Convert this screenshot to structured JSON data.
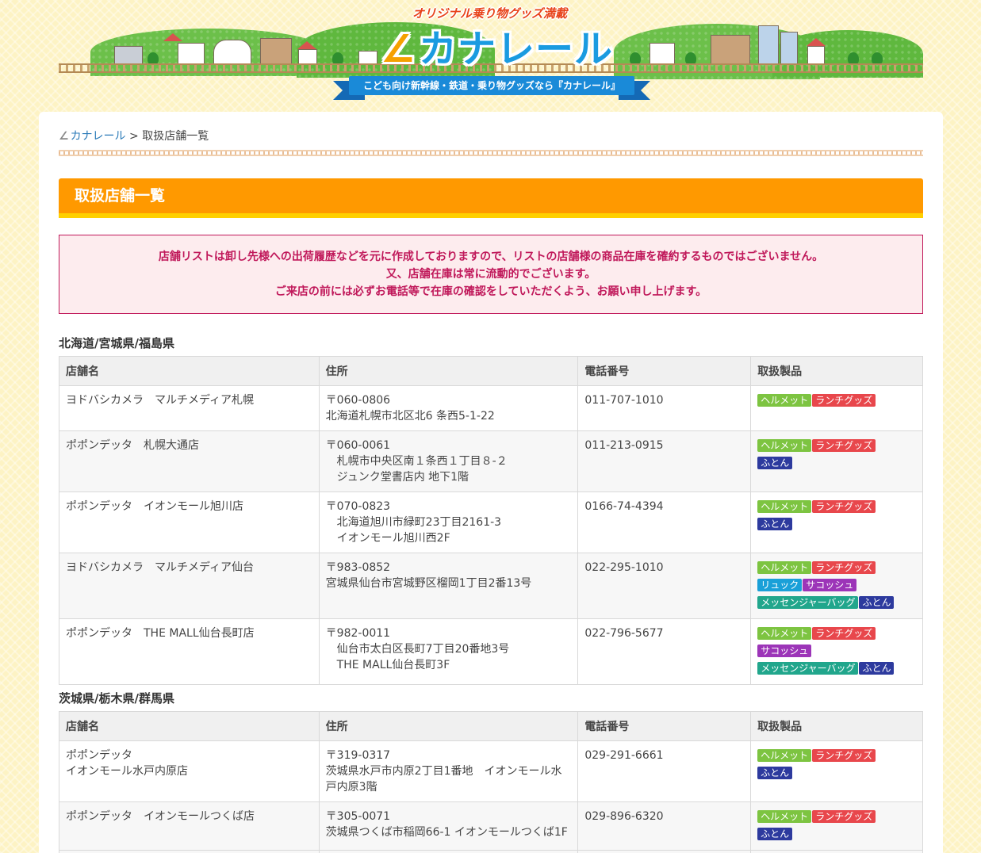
{
  "header": {
    "tagline_top": "オリジナル乗り物グッズ満載",
    "logo_text": "カナレール",
    "ribbon_text": "こども向け新幹線・鉄道・乗り物グッズなら『カナレール』"
  },
  "breadcrumb": {
    "home": "カナレール",
    "separator": ">",
    "current": "取扱店舗一覧"
  },
  "page_title": "取扱店舗一覧",
  "notice": {
    "line1": "店舗リストは卸し先様への出荷履歴などを元に作成しておりますので、リストの店舗様の商品在庫を確約するものではございません。",
    "line2": "又、店舗在庫は常に流動的でございます。",
    "line3": "ご来店の前には必ずお電話等で在庫の確認をしていただくよう、お願い申し上げます。"
  },
  "columns": {
    "name": "店舗名",
    "address": "住所",
    "phone": "電話番号",
    "products": "取扱製品"
  },
  "tag_labels": {
    "helmet": "ヘルメット",
    "lunch": "ランチグッズ",
    "futon": "ふとん",
    "ryuck": "リュック",
    "sacoche": "サコッシュ",
    "messenger": "メッセンジャーバッグ"
  },
  "regions": [
    {
      "name": "北海道/宮城県/福島県",
      "stores": [
        {
          "name": "ヨドバシカメラ　マルチメディア札幌",
          "zip": "〒060-0806",
          "addr": "北海道札幌市北区北6 条西5-1-22",
          "addr2": "",
          "phone": "011-707-1010"
        },
        {
          "name": "ポポンデッタ　札幌大通店",
          "zip": "〒060-0061",
          "addr": "札幌市中央区南１条西１丁目８-２",
          "addr2": "ジュンク堂書店内 地下1階",
          "phone": "011-213-0915"
        },
        {
          "name": "ポポンデッタ　イオンモール旭川店",
          "zip": "〒070-0823",
          "addr": "北海道旭川市緑町23丁目2161-3",
          "addr2": "イオンモール旭川西2F",
          "phone": "0166-74-4394"
        },
        {
          "name": "ヨドバシカメラ　マルチメディア仙台",
          "zip": "〒983-0852",
          "addr": "宮城県仙台市宮城野区榴岡1丁目2番13号",
          "addr2": "",
          "phone": "022-295-1010"
        },
        {
          "name": "ポポンデッタ　THE MALL仙台長町店",
          "zip": "〒982-0011",
          "addr": "仙台市太白区長町7丁目20番地3号",
          "addr2": "THE MALL仙台長町3F",
          "phone": "022-796-5677"
        }
      ]
    },
    {
      "name": "茨城県/栃木県/群馬県",
      "stores": [
        {
          "name": "ポポンデッタ",
          "name2": "イオンモール水戸内原店",
          "zip": "〒319-0317",
          "addr": "茨城県水戸市内原2丁目1番地　イオンモール水",
          "addr2": "戸内原3階",
          "phone": "029-291-6661"
        },
        {
          "name": "ポポンデッタ　イオンモールつくば店",
          "zip": "〒305-0071",
          "addr": "茨城県つくば市稲岡66-1 イオンモールつくば1F",
          "addr2": "",
          "phone": "029-896-6320"
        }
      ]
    }
  ],
  "colors": {
    "title_bar": "#ff9900",
    "notice_text": "#c0185a",
    "logo_blue": "#1a9be0",
    "ribbon": "#1a8ad8"
  }
}
